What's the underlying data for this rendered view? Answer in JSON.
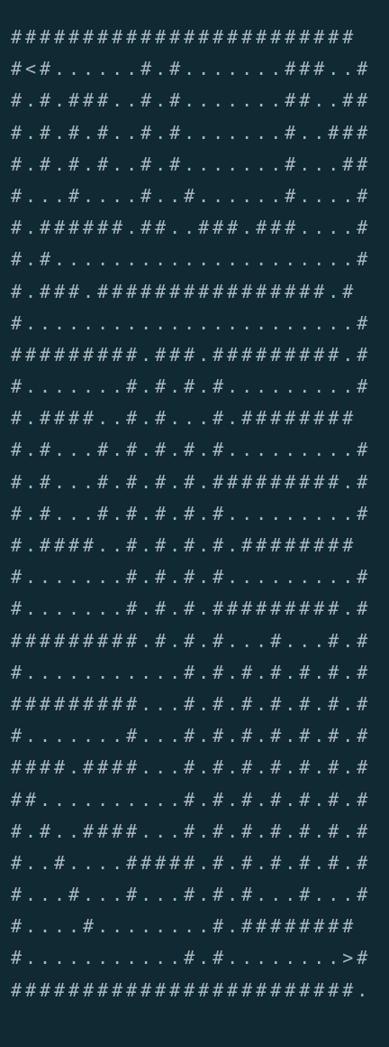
{
  "maze": {
    "rows": [
      "########################",
      "#<#......#.#.......###..#",
      "#.#.###..#.#.......##..##",
      "#.#.#.#..#.#.......#..###",
      "#.#.#.#..#.#.......#...##",
      "#...#....#..#......#....#",
      "#.######.##..###.###....#",
      "#.#.....................#",
      "#.###.################.#",
      "#.......................#",
      "#########.###.#########.#",
      "#.......#.#.#.#.........#",
      "#.####..#.#...#.########",
      "#.#...#.#.#.#.#.........#",
      "#.#...#.#.#.#.#########.#",
      "#.#...#.#.#.#.#.........#",
      "#.####..#.#.#.#.########",
      "#.......#.#.#.#.........#",
      "#.......#.#.#.#########.#",
      "#########.#.#.#...#...#.#",
      "#...........#.#.#.#.#.#.#",
      "#########...#.#.#.#.#.#.#",
      "#.......#...#.#.#.#.#.#.#",
      "####.####...#.#.#.#.#.#.#",
      "##..........#.#.#.#.#.#.#",
      "#.#..####...#.#.#.#.#.#.#",
      "#..#....#####.#.#.#.#.#.#",
      "#...#...#...#.#.#...#...#",
      "#....#........#.########",
      "#...........#.#........>#",
      "########################."
    ]
  }
}
